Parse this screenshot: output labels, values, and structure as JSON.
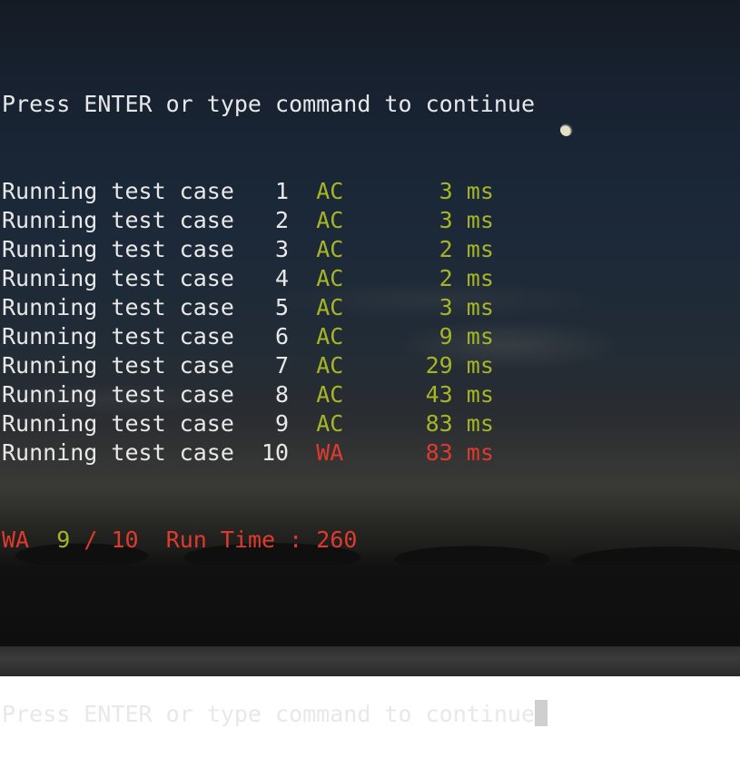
{
  "background": {
    "scene": "night sky over tree line",
    "moon": "crescent-moon"
  },
  "colors": {
    "text": "#e8e8e8",
    "accepted": "#a6b526",
    "wrong_answer": "#e03a2f",
    "cursor": "#cfcfcf"
  },
  "terminal": {
    "prompt_top": "Press ENTER or type command to continue",
    "test_rows": [
      {
        "label": "Running test case",
        "num": "1",
        "verdict": "AC",
        "time": "3",
        "unit": "ms"
      },
      {
        "label": "Running test case",
        "num": "2",
        "verdict": "AC",
        "time": "3",
        "unit": "ms"
      },
      {
        "label": "Running test case",
        "num": "3",
        "verdict": "AC",
        "time": "2",
        "unit": "ms"
      },
      {
        "label": "Running test case",
        "num": "4",
        "verdict": "AC",
        "time": "2",
        "unit": "ms"
      },
      {
        "label": "Running test case",
        "num": "5",
        "verdict": "AC",
        "time": "3",
        "unit": "ms"
      },
      {
        "label": "Running test case",
        "num": "6",
        "verdict": "AC",
        "time": "9",
        "unit": "ms"
      },
      {
        "label": "Running test case",
        "num": "7",
        "verdict": "AC",
        "time": "29",
        "unit": "ms"
      },
      {
        "label": "Running test case",
        "num": "8",
        "verdict": "AC",
        "time": "43",
        "unit": "ms"
      },
      {
        "label": "Running test case",
        "num": "9",
        "verdict": "AC",
        "time": "83",
        "unit": "ms"
      },
      {
        "label": "Running test case",
        "num": "10",
        "verdict": "WA",
        "time": "83",
        "unit": "ms"
      }
    ],
    "summary": {
      "verdict": "WA",
      "passed": "9",
      "separator": "/",
      "total": "10",
      "runtime_label": "Run Time :",
      "runtime_value": "260"
    },
    "prompt_bottom": "Press ENTER or type command to continue"
  }
}
